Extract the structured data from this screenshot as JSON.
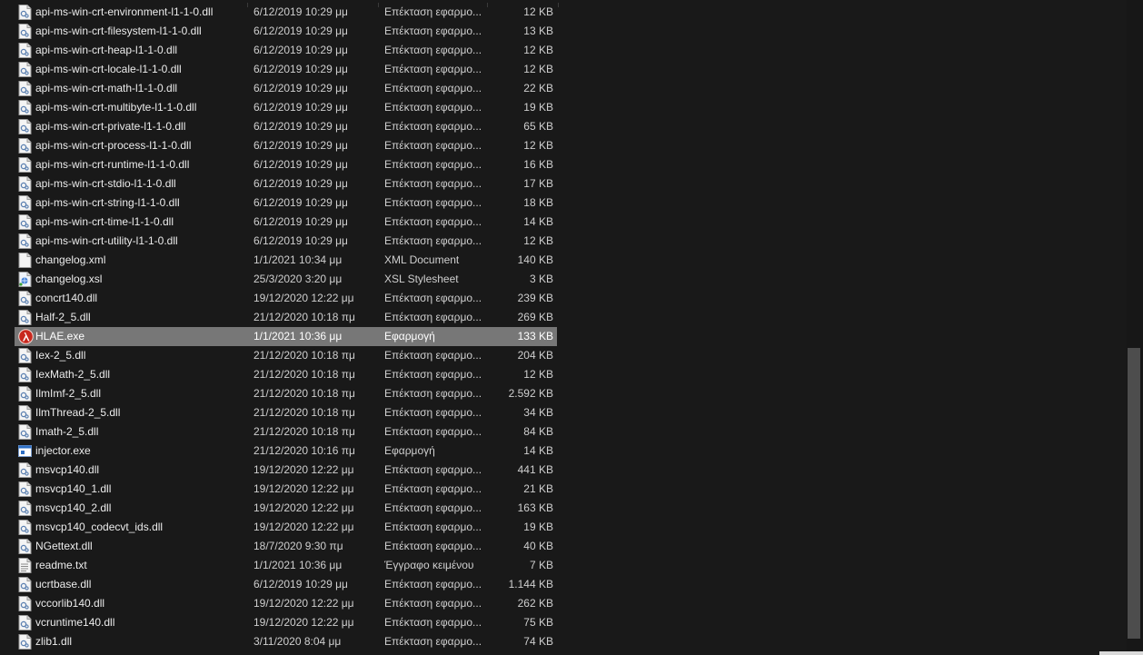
{
  "files": [
    {
      "name": "api-ms-win-crt-environment-l1-1-0.dll",
      "date": "6/12/2019 10:29 μμ",
      "type": "Επέκταση εφαρμο...",
      "size": "12 KB",
      "icon": "dll-icon"
    },
    {
      "name": "api-ms-win-crt-filesystem-l1-1-0.dll",
      "date": "6/12/2019 10:29 μμ",
      "type": "Επέκταση εφαρμο...",
      "size": "13 KB",
      "icon": "dll-icon"
    },
    {
      "name": "api-ms-win-crt-heap-l1-1-0.dll",
      "date": "6/12/2019 10:29 μμ",
      "type": "Επέκταση εφαρμο...",
      "size": "12 KB",
      "icon": "dll-icon"
    },
    {
      "name": "api-ms-win-crt-locale-l1-1-0.dll",
      "date": "6/12/2019 10:29 μμ",
      "type": "Επέκταση εφαρμο...",
      "size": "12 KB",
      "icon": "dll-icon"
    },
    {
      "name": "api-ms-win-crt-math-l1-1-0.dll",
      "date": "6/12/2019 10:29 μμ",
      "type": "Επέκταση εφαρμο...",
      "size": "22 KB",
      "icon": "dll-icon"
    },
    {
      "name": "api-ms-win-crt-multibyte-l1-1-0.dll",
      "date": "6/12/2019 10:29 μμ",
      "type": "Επέκταση εφαρμο...",
      "size": "19 KB",
      "icon": "dll-icon"
    },
    {
      "name": "api-ms-win-crt-private-l1-1-0.dll",
      "date": "6/12/2019 10:29 μμ",
      "type": "Επέκταση εφαρμο...",
      "size": "65 KB",
      "icon": "dll-icon"
    },
    {
      "name": "api-ms-win-crt-process-l1-1-0.dll",
      "date": "6/12/2019 10:29 μμ",
      "type": "Επέκταση εφαρμο...",
      "size": "12 KB",
      "icon": "dll-icon"
    },
    {
      "name": "api-ms-win-crt-runtime-l1-1-0.dll",
      "date": "6/12/2019 10:29 μμ",
      "type": "Επέκταση εφαρμο...",
      "size": "16 KB",
      "icon": "dll-icon"
    },
    {
      "name": "api-ms-win-crt-stdio-l1-1-0.dll",
      "date": "6/12/2019 10:29 μμ",
      "type": "Επέκταση εφαρμο...",
      "size": "17 KB",
      "icon": "dll-icon"
    },
    {
      "name": "api-ms-win-crt-string-l1-1-0.dll",
      "date": "6/12/2019 10:29 μμ",
      "type": "Επέκταση εφαρμο...",
      "size": "18 KB",
      "icon": "dll-icon"
    },
    {
      "name": "api-ms-win-crt-time-l1-1-0.dll",
      "date": "6/12/2019 10:29 μμ",
      "type": "Επέκταση εφαρμο...",
      "size": "14 KB",
      "icon": "dll-icon"
    },
    {
      "name": "api-ms-win-crt-utility-l1-1-0.dll",
      "date": "6/12/2019 10:29 μμ",
      "type": "Επέκταση εφαρμο...",
      "size": "12 KB",
      "icon": "dll-icon"
    },
    {
      "name": "changelog.xml",
      "date": "1/1/2021 10:34 μμ",
      "type": "XML Document",
      "size": "140 KB",
      "icon": "document-icon"
    },
    {
      "name": "changelog.xsl",
      "date": "25/3/2020 3:20 μμ",
      "type": "XSL Stylesheet",
      "size": "3 KB",
      "icon": "stylesheet-icon"
    },
    {
      "name": "concrt140.dll",
      "date": "19/12/2020 12:22 μμ",
      "type": "Επέκταση εφαρμο...",
      "size": "239 KB",
      "icon": "dll-icon"
    },
    {
      "name": "Half-2_5.dll",
      "date": "21/12/2020 10:18 πμ",
      "type": "Επέκταση εφαρμο...",
      "size": "269 KB",
      "icon": "dll-icon"
    },
    {
      "name": "HLAE.exe",
      "date": "1/1/2021 10:36 μμ",
      "type": "Εφαρμογή",
      "size": "133 KB",
      "icon": "half-life-lambda-icon",
      "selected": true
    },
    {
      "name": "Iex-2_5.dll",
      "date": "21/12/2020 10:18 πμ",
      "type": "Επέκταση εφαρμο...",
      "size": "204 KB",
      "icon": "dll-icon"
    },
    {
      "name": "IexMath-2_5.dll",
      "date": "21/12/2020 10:18 πμ",
      "type": "Επέκταση εφαρμο...",
      "size": "12 KB",
      "icon": "dll-icon"
    },
    {
      "name": "IlmImf-2_5.dll",
      "date": "21/12/2020 10:18 πμ",
      "type": "Επέκταση εφαρμο...",
      "size": "2.592 KB",
      "icon": "dll-icon"
    },
    {
      "name": "IlmThread-2_5.dll",
      "date": "21/12/2020 10:18 πμ",
      "type": "Επέκταση εφαρμο...",
      "size": "34 KB",
      "icon": "dll-icon"
    },
    {
      "name": "Imath-2_5.dll",
      "date": "21/12/2020 10:18 πμ",
      "type": "Επέκταση εφαρμο...",
      "size": "84 KB",
      "icon": "dll-icon"
    },
    {
      "name": "injector.exe",
      "date": "21/12/2020 10:16 πμ",
      "type": "Εφαρμογή",
      "size": "14 KB",
      "icon": "application-icon"
    },
    {
      "name": "msvcp140.dll",
      "date": "19/12/2020 12:22 μμ",
      "type": "Επέκταση εφαρμο...",
      "size": "441 KB",
      "icon": "dll-icon"
    },
    {
      "name": "msvcp140_1.dll",
      "date": "19/12/2020 12:22 μμ",
      "type": "Επέκταση εφαρμο...",
      "size": "21 KB",
      "icon": "dll-icon"
    },
    {
      "name": "msvcp140_2.dll",
      "date": "19/12/2020 12:22 μμ",
      "type": "Επέκταση εφαρμο...",
      "size": "163 KB",
      "icon": "dll-icon"
    },
    {
      "name": "msvcp140_codecvt_ids.dll",
      "date": "19/12/2020 12:22 μμ",
      "type": "Επέκταση εφαρμο...",
      "size": "19 KB",
      "icon": "dll-icon"
    },
    {
      "name": "NGettext.dll",
      "date": "18/7/2020 9:30 πμ",
      "type": "Επέκταση εφαρμο...",
      "size": "40 KB",
      "icon": "dll-icon"
    },
    {
      "name": "readme.txt",
      "date": "1/1/2021 10:36 μμ",
      "type": "Έγγραφο κειμένου",
      "size": "7 KB",
      "icon": "text-file-icon"
    },
    {
      "name": "ucrtbase.dll",
      "date": "6/12/2019 10:29 μμ",
      "type": "Επέκταση εφαρμο...",
      "size": "1.144 KB",
      "icon": "dll-icon"
    },
    {
      "name": "vccorlib140.dll",
      "date": "19/12/2020 12:22 μμ",
      "type": "Επέκταση εφαρμο...",
      "size": "262 KB",
      "icon": "dll-icon"
    },
    {
      "name": "vcruntime140.dll",
      "date": "19/12/2020 12:22 μμ",
      "type": "Επέκταση εφαρμο...",
      "size": "75 KB",
      "icon": "dll-icon"
    },
    {
      "name": "zlib1.dll",
      "date": "3/11/2020 8:04 μμ",
      "type": "Επέκταση εφαρμο...",
      "size": "74 KB",
      "icon": "dll-icon"
    }
  ]
}
